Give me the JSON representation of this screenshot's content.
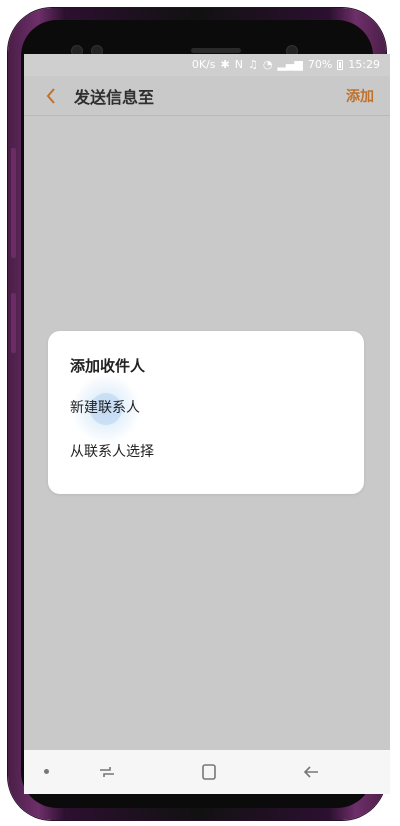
{
  "status_bar": {
    "speed": "0K/s",
    "battery": "70%",
    "time": "15:29"
  },
  "header": {
    "title": "发送信息至",
    "add_label": "添加"
  },
  "dialog": {
    "title": "添加收件人",
    "options": [
      "新建联系人",
      "从联系人选择"
    ]
  },
  "colors": {
    "accent": "#c0712a",
    "dim_background": "#c9c9c9",
    "dialog_background": "#ffffff"
  },
  "icons": {
    "back": "chevron-left-icon",
    "recent_apps": "recent-apps-icon",
    "home": "home-icon",
    "nav_back": "arrow-left-icon"
  }
}
